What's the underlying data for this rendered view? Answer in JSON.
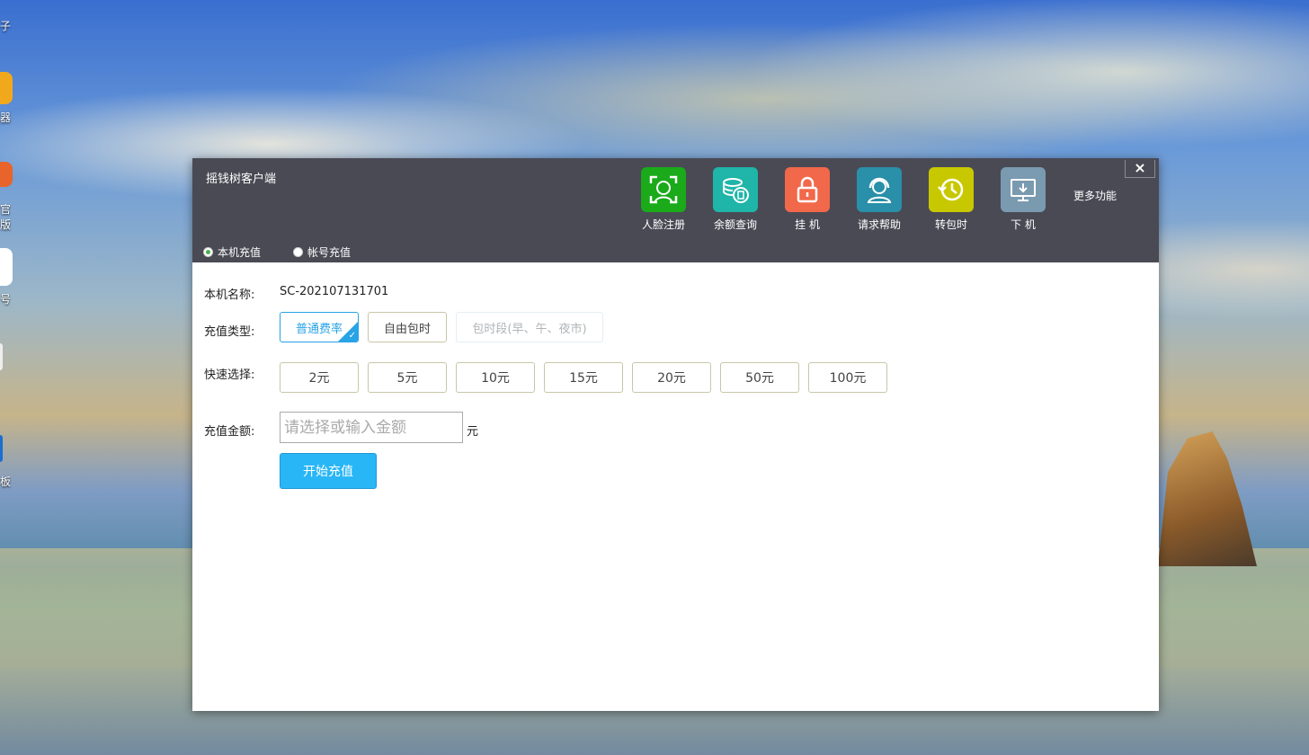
{
  "window": {
    "title": "摇钱树客户端",
    "close": "×"
  },
  "toolbar": {
    "items": [
      {
        "label": "人脸注册",
        "icon": "face-scan-icon",
        "color": "#1aaa1a"
      },
      {
        "label": "余额查询",
        "icon": "coins-icon",
        "color": "#1fb5a8"
      },
      {
        "label": "挂  机",
        "icon": "lock-icon",
        "color": "#f2684a"
      },
      {
        "label": "请求帮助",
        "icon": "support-agent-icon",
        "color": "#2a8fa8"
      },
      {
        "label": "转包时",
        "icon": "clock-switch-icon",
        "color": "#c8c800"
      },
      {
        "label": "下  机",
        "icon": "monitor-download-icon",
        "color": "#7a9ab0"
      }
    ],
    "more": "更多功能"
  },
  "mode": {
    "local": "本机充值",
    "account": "帐号充值",
    "selected": "本机充值"
  },
  "form": {
    "machine_label": "本机名称:",
    "machine_value": "SC-202107131701",
    "type_label": "充值类型:",
    "types": [
      {
        "label": "普通费率",
        "state": "selected"
      },
      {
        "label": "自由包时",
        "state": "normal"
      },
      {
        "label": "包时段(早、午、夜市)",
        "state": "disabled"
      }
    ],
    "quick_label": "快速选择:",
    "quick": [
      "2元",
      "5元",
      "10元",
      "15元",
      "20元",
      "50元",
      "100元"
    ],
    "amount_label": "充值金额:",
    "amount_placeholder": "请选择或输入金额",
    "amount_value": "",
    "unit": "元",
    "submit": "开始充值"
  },
  "colors": {
    "titlebar": "#4a4a55",
    "accent": "#27a3e6",
    "submit": "#29b6f6"
  },
  "desktop": {
    "labels": [
      "子",
      "器",
      "官",
      "版",
      "号",
      "板"
    ]
  }
}
